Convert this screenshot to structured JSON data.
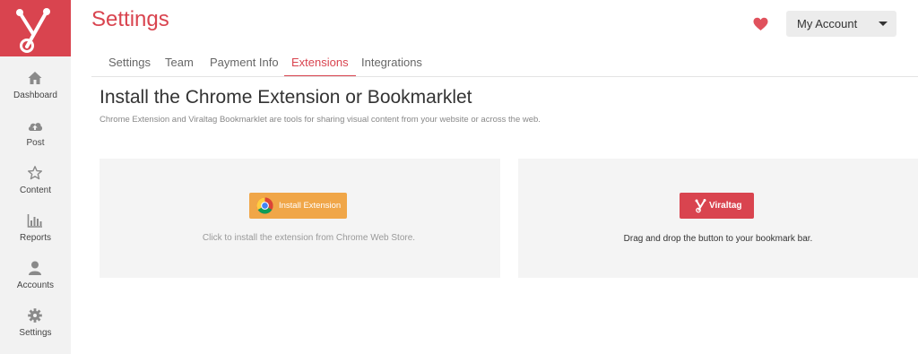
{
  "page": {
    "title": "Settings"
  },
  "sidebar": {
    "items": [
      {
        "label": "Dashboard",
        "icon": "home-icon"
      },
      {
        "label": "Post",
        "icon": "cloud-upload-icon"
      },
      {
        "label": "Content",
        "icon": "star-icon"
      },
      {
        "label": "Reports",
        "icon": "bar-chart-icon"
      },
      {
        "label": "Accounts",
        "icon": "user-icon"
      },
      {
        "label": "Settings",
        "icon": "gear-icon"
      }
    ]
  },
  "header": {
    "account_label": "My Account"
  },
  "tabs": [
    {
      "label": "Settings"
    },
    {
      "label": "Team"
    },
    {
      "label": "Payment Info"
    },
    {
      "label": "Extensions",
      "active": true
    },
    {
      "label": "Integrations"
    }
  ],
  "main": {
    "heading": "Install the Chrome Extension or Bookmarklet",
    "subtext": "Chrome Extension and Viraltag Bookmarklet are tools for sharing visual content from your website or across the web.",
    "extension": {
      "button_label": "Install Extension",
      "help": "Click to install the extension from Chrome Web Store."
    },
    "bookmarklet": {
      "button_label": "Viraltag",
      "help": "Drag and drop the button to your bookmark bar."
    }
  },
  "colors": {
    "brand": "#d9444f",
    "install_button": "#f0a648",
    "sidebar_bg": "#f2f2f2",
    "panel_bg": "#f4f4f4"
  }
}
